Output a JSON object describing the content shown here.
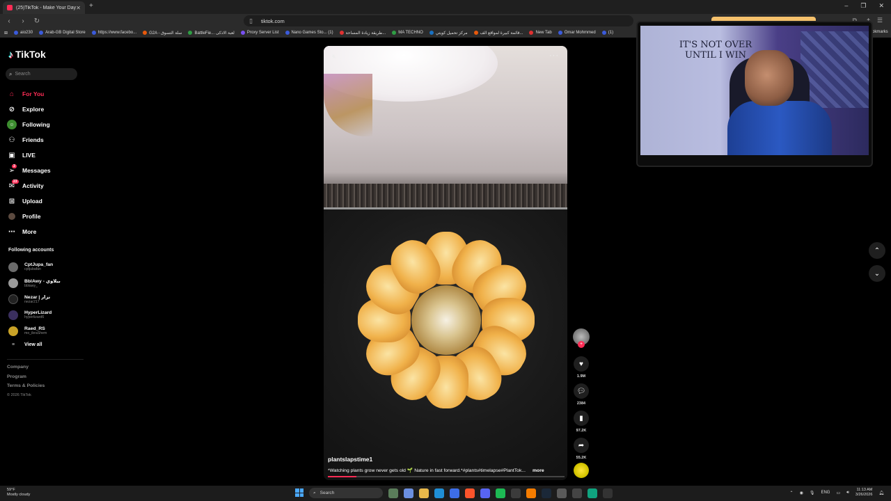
{
  "browser": {
    "tab_title": "(25)TikTok - Make Your Day",
    "url": "tiktok.com",
    "bookmarks": [
      "aio230",
      "Arab-GB Digital Store",
      "https://www.facebo...",
      "G2A - سلة التسوق",
      "BattleFie... لعبة الاذكى",
      "Proxy Server List",
      "Nano Games Sto... (1)",
      "طريقة زيادة المساحة...",
      "MA TECHNO",
      "مركز تحميل كويتي",
      "قائمة كبيرة لمواقع الف...",
      "New Tab",
      "Omar Mohmmed",
      "(1)"
    ],
    "bookmarks_end": "okmarks"
  },
  "sidebar": {
    "logo": "TikTok",
    "search_placeholder": "Search",
    "menu": [
      {
        "label": "For You",
        "icon": "home-icon",
        "active": true
      },
      {
        "label": "Explore",
        "icon": "compass-icon"
      },
      {
        "label": "Following",
        "icon": "following-icon"
      },
      {
        "label": "Friends",
        "icon": "friends-icon"
      },
      {
        "label": "LIVE",
        "icon": "live-icon"
      },
      {
        "label": "Messages",
        "icon": "messages-icon",
        "badge": "3"
      },
      {
        "label": "Activity",
        "icon": "activity-icon",
        "badge": "23"
      },
      {
        "label": "Upload",
        "icon": "upload-icon"
      },
      {
        "label": "Profile",
        "icon": "profile-icon"
      },
      {
        "label": "More",
        "icon": "more-icon"
      }
    ],
    "following_title": "Following accounts",
    "accounts": [
      {
        "name": "CptJupa_fan",
        "handle": "cptjubafan"
      },
      {
        "name": "BblAwy - بيلاوي",
        "handle": "bblawy_"
      },
      {
        "name": "Nezar | نزار",
        "handle": "nezar217"
      },
      {
        "name": "HyperLizard",
        "handle": "hyperlizard6"
      },
      {
        "name": "Raed_RS",
        "handle": "mo_ibraShem"
      }
    ],
    "view_all": "View all",
    "footer": {
      "company": "Company",
      "program": "Program",
      "terms": "Terms & Policies",
      "copyright": "© 2026 TikTok"
    }
  },
  "video": {
    "author": "plantslapstime1",
    "caption": "*Watching plants grow never gets old 🌱 Nature in fast forward.*#plants#timelapse#PlantTok...",
    "more": "more",
    "progress": 0.12,
    "likes": "1.9M",
    "comments": "2384",
    "saves": "97.2K",
    "shares": "55.2K"
  },
  "webcam": {
    "sign_line1": "IT'S NOT OVER",
    "sign_line2": "UNTIL I WIN"
  },
  "taskbar": {
    "temp": "59°F",
    "weather": "Mostly cloudy",
    "search": "Search",
    "lang": "ENG",
    "time": "11:13 AM",
    "date": "3/26/2026"
  },
  "colors": {
    "accent": "#fe2c55",
    "background": "#000000"
  }
}
